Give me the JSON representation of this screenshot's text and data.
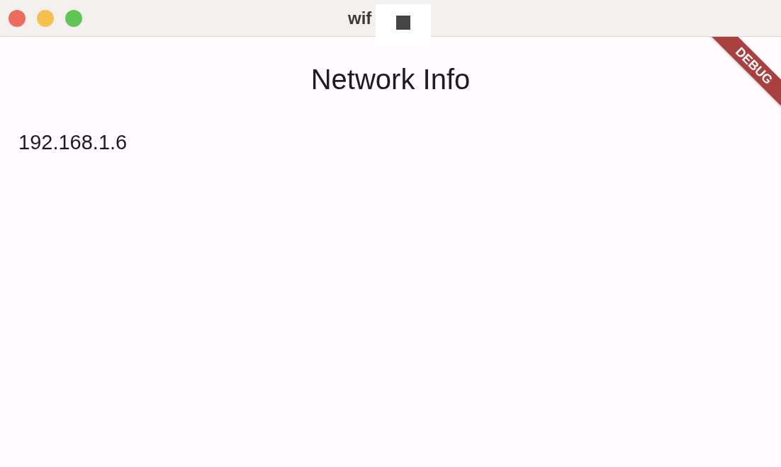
{
  "window": {
    "title": "wif"
  },
  "app_bar": {
    "title": "Network Info"
  },
  "body": {
    "ip_address": "192.168.1.6"
  },
  "debug_banner": {
    "label": "DEBUG"
  }
}
